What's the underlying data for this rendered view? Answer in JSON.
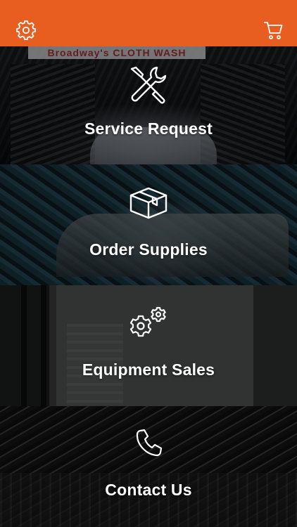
{
  "header": {
    "color": "#e85e21",
    "settings_icon": "gear-icon",
    "cart_icon": "cart-icon"
  },
  "banner_text": "Broadway's CLOTH WASH",
  "tiles": [
    {
      "label": "Service Request",
      "icon": "tools-icon"
    },
    {
      "label": "Order Supplies",
      "icon": "box-icon"
    },
    {
      "label": "Equipment Sales",
      "icon": "gears-icon"
    },
    {
      "label": "Contact Us",
      "icon": "phone-icon"
    }
  ]
}
